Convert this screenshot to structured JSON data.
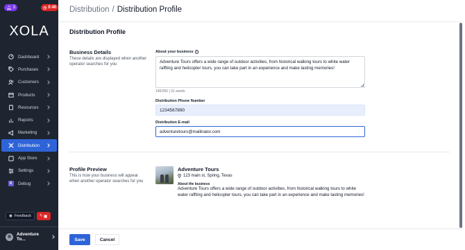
{
  "sidebar": {
    "badge_left": "3",
    "badge_right": "0:40",
    "logo": "XOLA",
    "items": [
      {
        "label": "Dashboard",
        "icon": "dashboard-icon"
      },
      {
        "label": "Purchases",
        "icon": "tag-icon"
      },
      {
        "label": "Customers",
        "icon": "users-icon"
      },
      {
        "label": "Products",
        "icon": "box-icon"
      },
      {
        "label": "Resources",
        "icon": "clipboard-icon"
      },
      {
        "label": "Reports",
        "icon": "bar-chart-icon"
      },
      {
        "label": "Marketing",
        "icon": "megaphone-icon"
      },
      {
        "label": "Distribution",
        "icon": "distribution-icon",
        "active": true
      },
      {
        "label": "App Store",
        "icon": "app-store-icon"
      },
      {
        "label": "Settings",
        "icon": "sliders-icon"
      },
      {
        "label": "Debug",
        "icon": "x-box-icon"
      }
    ],
    "feedback_label": "Feedback",
    "account_name": "Adventure To..."
  },
  "header": {
    "crumb_parent": "Distribution",
    "crumb_sep": "/",
    "crumb_current": "Distribution Profile"
  },
  "form": {
    "section_title": "Distribution Profile",
    "business_details_title": "Business Details",
    "business_details_desc": "These details are displayed when another operator searches for you",
    "about_label": "About your business",
    "about_value": "Adventure Tours offers a wide range of outdoor activities, from historical walking tours to white water raffting and helicopter tours, you can take part in an experience and make lasting memories!",
    "about_counter": "196/350  |  31 words",
    "phone_label": "Distribution Phone Number",
    "phone_value": "1234567890",
    "email_label": "Distribution E-mail",
    "email_value": "adventuretours@mailinator.com"
  },
  "preview": {
    "title": "Profile Preview",
    "desc": "This is how your business will appear when another operator searches for you",
    "name": "Adventure Tours",
    "location": "123 main st, Spring, Texas",
    "about_label": "About the business",
    "about_text": "Adventure Tours offers a wide range of outdoor activities, from historical walking tours to white water raffting and helicopter tours, you can take part in an experience and make lasting memories!"
  },
  "footer": {
    "save_label": "Save",
    "cancel_label": "Cancel"
  },
  "colors": {
    "sidebar_bg": "#1e2530",
    "accent": "#2f64d8",
    "alert": "#dc2626",
    "badge_purple": "#7c3aed"
  }
}
